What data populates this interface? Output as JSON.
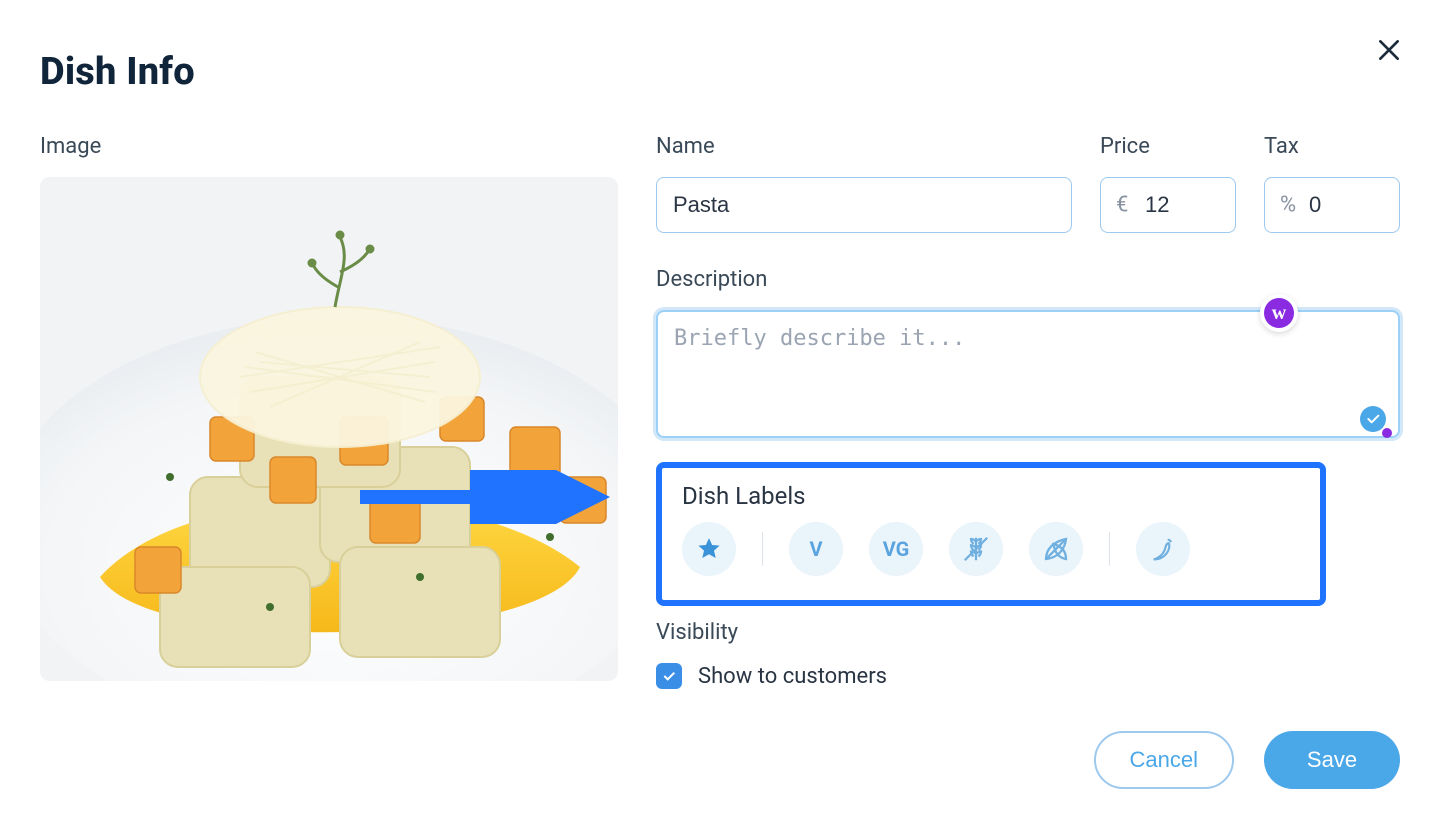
{
  "header": {
    "title": "Dish Info"
  },
  "close_btn": {
    "name": "close"
  },
  "image": {
    "label": "Image"
  },
  "fields": {
    "name": {
      "label": "Name",
      "value": "Pasta"
    },
    "price": {
      "label": "Price",
      "prefix": "€",
      "value": "12"
    },
    "tax": {
      "label": "Tax",
      "prefix": "%",
      "value": "0"
    },
    "description": {
      "label": "Description",
      "placeholder": "Briefly describe it...",
      "value": ""
    }
  },
  "labels": {
    "title": "Dish Labels",
    "items": [
      {
        "id": "star",
        "icon": "star",
        "text": "",
        "name": "special-dish"
      },
      {
        "id": "vegetarian",
        "icon": "text",
        "text": "V",
        "name": "vegetarian"
      },
      {
        "id": "vegan",
        "icon": "text",
        "text": "VG",
        "name": "vegan"
      },
      {
        "id": "gluten-free",
        "icon": "wheat",
        "text": "",
        "name": "gluten-free"
      },
      {
        "id": "organic",
        "icon": "leaf",
        "text": "",
        "name": "organic"
      },
      {
        "id": "spicy",
        "icon": "chili",
        "text": "",
        "name": "spicy"
      }
    ]
  },
  "visibility": {
    "label": "Visibility",
    "checkbox": {
      "checked": true,
      "label": "Show to customers"
    }
  },
  "extension_badge": {
    "letter": "w"
  },
  "footer": {
    "cancel": "Cancel",
    "save": "Save"
  },
  "annotation": {
    "arrow": true
  }
}
